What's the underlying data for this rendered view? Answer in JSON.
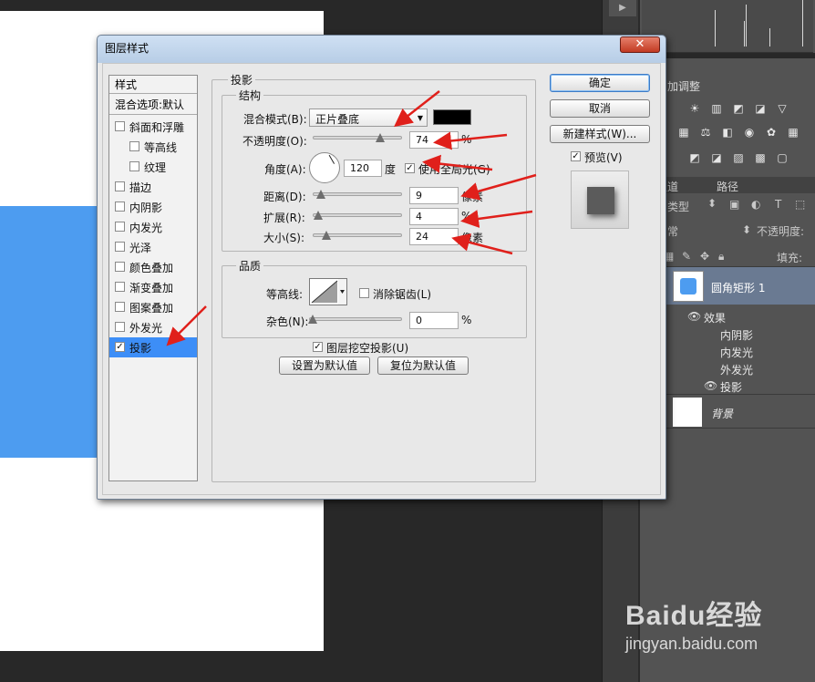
{
  "dialog": {
    "title": "图层样式",
    "close_label": "✕",
    "styles_list": {
      "header": "样式",
      "blend_options": "混合选项:默认",
      "items": [
        {
          "label": "斜面和浮雕",
          "checked": false
        },
        {
          "label": "等高线",
          "checked": false
        },
        {
          "label": "纹理",
          "checked": false
        },
        {
          "label": "描边",
          "checked": false
        },
        {
          "label": "内阴影",
          "checked": false
        },
        {
          "label": "内发光",
          "checked": false
        },
        {
          "label": "光泽",
          "checked": false
        },
        {
          "label": "颜色叠加",
          "checked": false
        },
        {
          "label": "渐变叠加",
          "checked": false
        },
        {
          "label": "图案叠加",
          "checked": false
        },
        {
          "label": "外发光",
          "checked": false
        },
        {
          "label": "投影",
          "checked": true
        }
      ]
    },
    "panel_title": "投影",
    "structure": {
      "title": "结构",
      "blend_mode_label": "混合模式(B):",
      "blend_mode_value": "正片叠底",
      "blend_color": "#000000",
      "opacity_label": "不透明度(O):",
      "opacity_value": "74",
      "opacity_unit": "%",
      "angle_label": "角度(A):",
      "angle_value": "120",
      "angle_unit": "度",
      "global_light_label": "使用全局光(G)",
      "global_light_checked": true,
      "distance_label": "距离(D):",
      "distance_value": "9",
      "distance_unit": "像素",
      "spread_label": "扩展(R):",
      "spread_value": "4",
      "spread_unit": "%",
      "size_label": "大小(S):",
      "size_value": "24",
      "size_unit": "像素"
    },
    "quality": {
      "title": "品质",
      "contour_label": "等高线:",
      "antialias_label": "消除锯齿(L)",
      "antialias_checked": false,
      "noise_label": "杂色(N):",
      "noise_value": "0",
      "noise_unit": "%"
    },
    "knockout_label": "图层挖空投影(U)",
    "knockout_checked": true,
    "set_default_label": "设置为默认值",
    "reset_default_label": "复位为默认值",
    "ok_label": "确定",
    "cancel_label": "取消",
    "new_style_label": "新建样式(W)...",
    "preview_label": "预览(V)",
    "preview_checked": true
  },
  "right_panels": {
    "adjustments_title": "加调整",
    "tabs": [
      "通道",
      "路径"
    ],
    "filter_label": "类型",
    "blend_label": "常",
    "opacity_label": "不透明度:",
    "fill_label": "填充:",
    "layers": [
      {
        "name": "圆角矩形 1",
        "selected": true
      },
      {
        "name": "背景",
        "selected": false
      }
    ],
    "effects_label": "效果",
    "effect_items": [
      "内阴影",
      "内发光",
      "外发光",
      "投影"
    ]
  },
  "watermark": {
    "logo": "Baidu经验",
    "url": "jingyan.baidu.com"
  },
  "colors": {
    "canvas_shape": "#4d9cf0",
    "selection": "#3d8ef7",
    "annotation_arrow": "#e0201b"
  }
}
